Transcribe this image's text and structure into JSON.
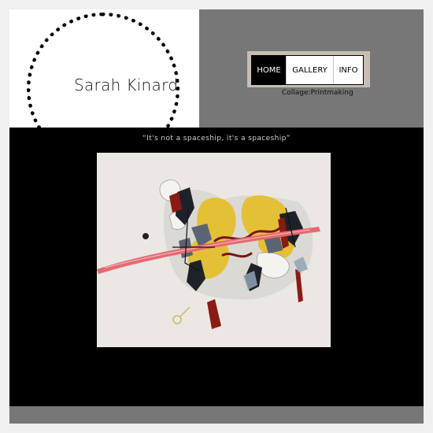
{
  "site": {
    "title": "Sarah Kinard",
    "tagline": "Collage:Printmaking"
  },
  "nav": {
    "items": [
      {
        "label": "HOME",
        "active": true
      },
      {
        "label": "GALLERY",
        "active": false
      },
      {
        "label": "INFO",
        "active": false
      }
    ]
  },
  "artwork": {
    "caption": "“It's not a spaceship, it's a spaceship”"
  },
  "colors": {
    "header_bg": "#ffffff",
    "sidebar_gray": "#767776",
    "nav_frame": "#c7bdb3",
    "main_bg": "#000000",
    "active_nav": "#000000"
  }
}
